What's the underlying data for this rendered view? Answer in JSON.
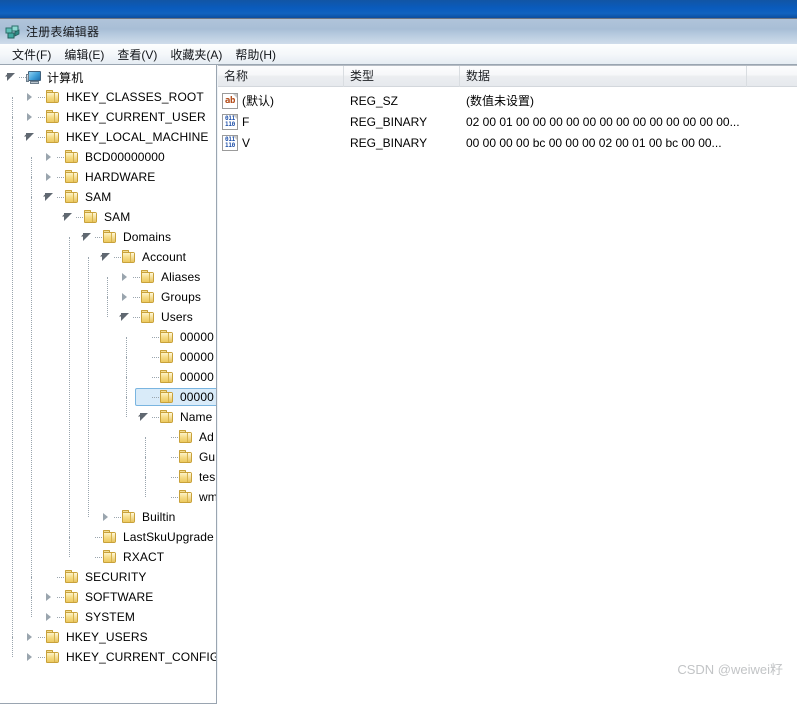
{
  "window": {
    "title": "注册表编辑器",
    "icon": "regedit-icon"
  },
  "menubar": {
    "items": [
      {
        "label": "文件(F)",
        "name": "menu-file"
      },
      {
        "label": "编辑(E)",
        "name": "menu-edit"
      },
      {
        "label": "查看(V)",
        "name": "menu-view"
      },
      {
        "label": "收藏夹(A)",
        "name": "menu-favorites"
      },
      {
        "label": "帮助(H)",
        "name": "menu-help"
      }
    ]
  },
  "tree": {
    "nodes": [
      {
        "label": "计算机",
        "level": 0,
        "state": "expanded",
        "icon": "computer-icon",
        "selected": false
      },
      {
        "label": "HKEY_CLASSES_ROOT",
        "level": 1,
        "state": "collapsed",
        "icon": "folder-icon",
        "selected": false
      },
      {
        "label": "HKEY_CURRENT_USER",
        "level": 1,
        "state": "collapsed",
        "icon": "folder-icon",
        "selected": false
      },
      {
        "label": "HKEY_LOCAL_MACHINE",
        "level": 1,
        "state": "expanded",
        "icon": "folder-icon",
        "selected": false
      },
      {
        "label": "BCD00000000",
        "level": 2,
        "state": "collapsed",
        "icon": "folder-icon",
        "selected": false
      },
      {
        "label": "HARDWARE",
        "level": 2,
        "state": "collapsed",
        "icon": "folder-icon",
        "selected": false
      },
      {
        "label": "SAM",
        "level": 2,
        "state": "expanded",
        "icon": "folder-icon",
        "selected": false
      },
      {
        "label": "SAM",
        "level": 3,
        "state": "expanded",
        "icon": "folder-icon",
        "selected": false
      },
      {
        "label": "Domains",
        "level": 4,
        "state": "expanded",
        "icon": "folder-icon",
        "selected": false
      },
      {
        "label": "Account",
        "level": 5,
        "state": "expanded",
        "icon": "folder-icon",
        "selected": false
      },
      {
        "label": "Aliases",
        "level": 6,
        "state": "collapsed",
        "icon": "folder-icon",
        "selected": false
      },
      {
        "label": "Groups",
        "level": 6,
        "state": "collapsed",
        "icon": "folder-icon",
        "selected": false
      },
      {
        "label": "Users",
        "level": 6,
        "state": "expanded",
        "icon": "folder-icon",
        "selected": false
      },
      {
        "label": "00000",
        "level": 7,
        "state": "leaf",
        "icon": "folder-icon",
        "selected": false
      },
      {
        "label": "00000",
        "level": 7,
        "state": "leaf",
        "icon": "folder-icon",
        "selected": false
      },
      {
        "label": "00000",
        "level": 7,
        "state": "leaf",
        "icon": "folder-icon",
        "selected": false
      },
      {
        "label": "00000",
        "level": 7,
        "state": "leaf",
        "icon": "folder-icon",
        "selected": true
      },
      {
        "label": "Name",
        "level": 7,
        "state": "expanded",
        "icon": "folder-icon",
        "selected": false
      },
      {
        "label": "Ad",
        "level": 8,
        "state": "leaf",
        "icon": "folder-icon",
        "selected": false
      },
      {
        "label": "Gu",
        "level": 8,
        "state": "leaf",
        "icon": "folder-icon",
        "selected": false
      },
      {
        "label": "tes",
        "level": 8,
        "state": "leaf",
        "icon": "folder-icon",
        "selected": false
      },
      {
        "label": "wm",
        "level": 8,
        "state": "leaf",
        "icon": "folder-icon",
        "selected": false
      },
      {
        "label": "Builtin",
        "level": 5,
        "state": "collapsed",
        "icon": "folder-icon",
        "selected": false
      },
      {
        "label": "LastSkuUpgrade",
        "level": 4,
        "state": "leaf",
        "icon": "folder-icon",
        "selected": false
      },
      {
        "label": "RXACT",
        "level": 4,
        "state": "leaf",
        "icon": "folder-icon",
        "selected": false
      },
      {
        "label": "SECURITY",
        "level": 2,
        "state": "leaf",
        "icon": "folder-icon",
        "selected": false
      },
      {
        "label": "SOFTWARE",
        "level": 2,
        "state": "collapsed",
        "icon": "folder-icon",
        "selected": false
      },
      {
        "label": "SYSTEM",
        "level": 2,
        "state": "collapsed",
        "icon": "folder-icon",
        "selected": false
      },
      {
        "label": "HKEY_USERS",
        "level": 1,
        "state": "collapsed",
        "icon": "folder-icon",
        "selected": false
      },
      {
        "label": "HKEY_CURRENT_CONFIG",
        "level": 1,
        "state": "collapsed",
        "icon": "folder-icon",
        "selected": false
      }
    ]
  },
  "list": {
    "columns": [
      {
        "label": "名称",
        "name": "column-name"
      },
      {
        "label": "类型",
        "name": "column-type"
      },
      {
        "label": "数据",
        "name": "column-data"
      }
    ],
    "rows": [
      {
        "name": "(默认)",
        "type": "REG_SZ",
        "data": "(数值未设置)",
        "icon": "string-value-icon"
      },
      {
        "name": "F",
        "type": "REG_BINARY",
        "data": "02 00 01 00 00 00 00 00 00 00 00 00 00 00 00 00...",
        "icon": "binary-value-icon"
      },
      {
        "name": "V",
        "type": "REG_BINARY",
        "data": "00 00 00 00 bc 00 00 00 02 00 01 00 bc 00 00...",
        "icon": "binary-value-icon"
      }
    ]
  },
  "watermark": {
    "text": "CSDN @weiwei籽"
  },
  "colors": {
    "selection_fill": "#d9ebf9",
    "selection_border": "#7ab5e0",
    "titlebar_top": "#b0c4da",
    "top_strip": "#0a5bbd",
    "folder_gold": "#ecc95f",
    "string_icon": "#b34a17",
    "binary_icon": "#1e4fa8"
  }
}
